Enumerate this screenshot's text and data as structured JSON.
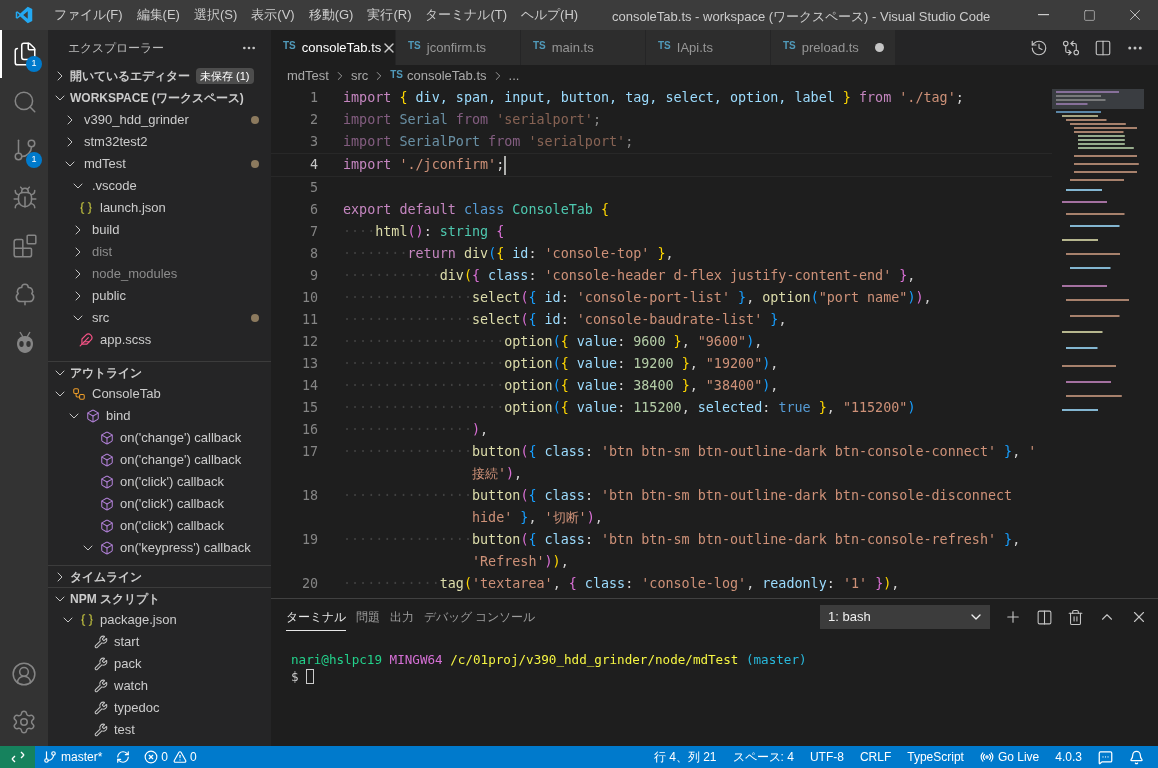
{
  "window": {
    "title": "consoleTab.ts - workspace (ワークスペース) - Visual Studio Code"
  },
  "menu": {
    "items": [
      "ファイル(F)",
      "編集(E)",
      "選択(S)",
      "表示(V)",
      "移動(G)",
      "実行(R)",
      "ターミナル(T)",
      "ヘルプ(H)"
    ]
  },
  "activity_bar": {
    "items": [
      {
        "kind": "files",
        "selected": true,
        "badge": "1"
      },
      {
        "kind": "search",
        "selected": false
      },
      {
        "kind": "source_control",
        "selected": false,
        "badge": "1"
      },
      {
        "kind": "run_debug",
        "selected": false
      },
      {
        "kind": "extensions",
        "selected": false
      },
      {
        "kind": "testing",
        "selected": false
      },
      {
        "kind": "alien",
        "selected": false
      }
    ],
    "bottom": [
      {
        "kind": "account"
      },
      {
        "kind": "settings"
      }
    ]
  },
  "sidebar": {
    "title": "エクスプローラー",
    "open_editors": {
      "label": "開いているエディター",
      "badge": "未保存 (1)",
      "expanded": false
    },
    "workspace": {
      "label": "WORKSPACE (ワークスペース)",
      "expanded": true,
      "items": [
        {
          "kind": "folder",
          "label": "v390_hdd_grinder",
          "expanded": false,
          "modified": true
        },
        {
          "kind": "folder",
          "label": "stm32test2",
          "expanded": false,
          "modified": false
        },
        {
          "kind": "folder",
          "label": "mdTest",
          "expanded": true,
          "modified": true,
          "children": [
            {
              "kind": "folder",
              "label": ".vscode",
              "expanded": true,
              "modified": false,
              "children": [
                {
                  "kind": "json",
                  "label": "launch.json"
                }
              ]
            },
            {
              "kind": "folder",
              "label": "build",
              "expanded": false,
              "modified": false
            },
            {
              "kind": "folder",
              "label": "dist",
              "expanded": false,
              "modified": false,
              "ignored": true
            },
            {
              "kind": "folder",
              "label": "node_modules",
              "expanded": false,
              "modified": false,
              "ignored": true
            },
            {
              "kind": "folder",
              "label": "public",
              "expanded": false,
              "modified": false
            },
            {
              "kind": "folder",
              "label": "src",
              "expanded": true,
              "modified": true,
              "children": [
                {
                  "kind": "scss",
                  "label": "app.scss"
                }
              ]
            }
          ]
        }
      ]
    },
    "outline": {
      "label": "アウトライン",
      "expanded": true,
      "items": [
        {
          "kind": "class",
          "label": "ConsoleTab",
          "expanded": true,
          "children": [
            {
              "kind": "member",
              "label": "bind",
              "expanded": true,
              "children": [
                {
                  "kind": "member",
                  "label": "on('change') callback"
                },
                {
                  "kind": "member",
                  "label": "on('change') callback"
                },
                {
                  "kind": "member",
                  "label": "on('click') callback"
                },
                {
                  "kind": "member",
                  "label": "on('click') callback"
                },
                {
                  "kind": "member",
                  "label": "on('click') callback"
                },
                {
                  "kind": "member",
                  "label": "on('keypress') callback",
                  "expanded": true
                }
              ]
            }
          ]
        }
      ]
    },
    "timeline": {
      "label": "タイムライン",
      "expanded": false
    },
    "npm_scripts": {
      "label": "NPM スクリプト",
      "expanded": true,
      "items": [
        {
          "kind": "package",
          "label": "package.json",
          "expanded": true,
          "children": [
            {
              "kind": "script",
              "label": "start"
            },
            {
              "kind": "script",
              "label": "pack"
            },
            {
              "kind": "script",
              "label": "watch"
            },
            {
              "kind": "script",
              "label": "typedoc"
            },
            {
              "kind": "script",
              "label": "test"
            }
          ]
        }
      ]
    }
  },
  "tabs": [
    {
      "label": "consoleTab.ts",
      "badge": "TS",
      "selected": true,
      "dirty": false
    },
    {
      "label": "jconfirm.ts",
      "badge": "TS",
      "selected": false,
      "dirty": false
    },
    {
      "label": "main.ts",
      "badge": "TS",
      "selected": false,
      "dirty": false
    },
    {
      "label": "IApi.ts",
      "badge": "TS",
      "selected": false,
      "dirty": false
    },
    {
      "label": "preload.ts",
      "badge": "TS",
      "selected": false,
      "dirty": true
    }
  ],
  "breadcrumb": [
    {
      "kind": "folder",
      "text": "mdTest"
    },
    {
      "kind": "folder",
      "text": "src"
    },
    {
      "kind": "file",
      "badge": "TS",
      "text": "consoleTab.ts"
    },
    {
      "kind": "more",
      "text": "..."
    }
  ],
  "editor": {
    "lines": [
      {
        "number": "1",
        "rows": [
          [
            {
              "kind": "keyword",
              "text": "import"
            },
            {
              "kind": "punct",
              "text": " "
            },
            {
              "kind": "bracket1",
              "text": "{"
            },
            {
              "kind": "property",
              "text": " div, span, input, button, tag, select, option, label "
            },
            {
              "kind": "bracket1",
              "text": "}"
            },
            {
              "kind": "keyword",
              "text": " from "
            },
            {
              "kind": "string",
              "text": "'./tag'"
            },
            {
              "kind": "punct",
              "text": ";"
            }
          ]
        ]
      },
      {
        "number": "2",
        "faded": true,
        "rows": [
          [
            {
              "kind": "keyword",
              "text": "import "
            },
            {
              "kind": "property",
              "text": "Serial"
            },
            {
              "kind": "keyword",
              "text": " from "
            },
            {
              "kind": "string",
              "text": "'serialport'"
            },
            {
              "kind": "punct",
              "text": ";"
            }
          ]
        ]
      },
      {
        "number": "3",
        "faded": true,
        "rows": [
          [
            {
              "kind": "keyword",
              "text": "import "
            },
            {
              "kind": "property",
              "text": "SerialPort"
            },
            {
              "kind": "keyword",
              "text": " from "
            },
            {
              "kind": "string",
              "text": "'serialport'"
            },
            {
              "kind": "punct",
              "text": ";"
            }
          ]
        ]
      },
      {
        "number": "4",
        "cursor": true,
        "rows": [
          [
            {
              "kind": "keyword",
              "text": "import "
            },
            {
              "kind": "string",
              "text": "'./jconfirm'"
            },
            {
              "kind": "punct",
              "text": ";"
            }
          ]
        ]
      },
      {
        "number": "5"
      },
      {
        "number": "6",
        "rows": [
          [
            {
              "kind": "keyword",
              "text": "export default "
            },
            {
              "kind": "storage",
              "text": "class "
            },
            {
              "kind": "type",
              "text": "ConsoleTab "
            },
            {
              "kind": "bracket1",
              "text": "{"
            }
          ]
        ]
      },
      {
        "number": "7",
        "rows": [
          [
            {
              "kind": "space",
              "text": "····"
            },
            {
              "kind": "function",
              "text": "html"
            },
            {
              "kind": "bracket2",
              "text": "()"
            },
            {
              "kind": "punct",
              "text": ": "
            },
            {
              "kind": "type",
              "text": "string"
            },
            {
              "kind": "punct",
              "text": " "
            },
            {
              "kind": "bracket2",
              "text": "{"
            }
          ]
        ]
      },
      {
        "number": "8",
        "rows": [
          [
            {
              "kind": "space",
              "text": "········"
            },
            {
              "kind": "keyword",
              "text": "return "
            },
            {
              "kind": "function",
              "text": "div"
            },
            {
              "kind": "bracket3",
              "text": "("
            },
            {
              "kind": "bracket1",
              "text": "{"
            },
            {
              "kind": "property",
              "text": " id"
            },
            {
              "kind": "punct",
              "text": ": "
            },
            {
              "kind": "string",
              "text": "'console-top'"
            },
            {
              "kind": "punct",
              "text": " "
            },
            {
              "kind": "bracket1",
              "text": "}"
            },
            {
              "kind": "punct",
              "text": ","
            }
          ]
        ]
      },
      {
        "number": "9",
        "rows": [
          [
            {
              "kind": "space",
              "text": "············"
            },
            {
              "kind": "function",
              "text": "div"
            },
            {
              "kind": "bracket1",
              "text": "("
            },
            {
              "kind": "bracket2",
              "text": "{"
            },
            {
              "kind": "property",
              "text": " class"
            },
            {
              "kind": "punct",
              "text": ": "
            },
            {
              "kind": "string",
              "text": "'console-header d-flex justify-content-end'"
            },
            {
              "kind": "punct",
              "text": " "
            },
            {
              "kind": "bracket2",
              "text": "}"
            },
            {
              "kind": "punct",
              "text": ","
            }
          ]
        ]
      },
      {
        "number": "10",
        "rows": [
          [
            {
              "kind": "space",
              "text": "················"
            },
            {
              "kind": "function",
              "text": "select"
            },
            {
              "kind": "bracket2",
              "text": "("
            },
            {
              "kind": "bracket3",
              "text": "{"
            },
            {
              "kind": "property",
              "text": " id"
            },
            {
              "kind": "punct",
              "text": ": "
            },
            {
              "kind": "string",
              "text": "'console-port-list'"
            },
            {
              "kind": "punct",
              "text": " "
            },
            {
              "kind": "bracket3",
              "text": "}"
            },
            {
              "kind": "punct",
              "text": ", "
            },
            {
              "kind": "function",
              "text": "option"
            },
            {
              "kind": "bracket3",
              "text": "("
            },
            {
              "kind": "string",
              "text": "\"port name\""
            },
            {
              "kind": "bracket3",
              "text": ")"
            },
            {
              "kind": "bracket2",
              "text": ")"
            },
            {
              "kind": "punct",
              "text": ","
            }
          ]
        ]
      },
      {
        "number": "11",
        "rows": [
          [
            {
              "kind": "space",
              "text": "················"
            },
            {
              "kind": "function",
              "text": "select"
            },
            {
              "kind": "bracket2",
              "text": "("
            },
            {
              "kind": "bracket3",
              "text": "{"
            },
            {
              "kind": "property",
              "text": " id"
            },
            {
              "kind": "punct",
              "text": ": "
            },
            {
              "kind": "string",
              "text": "'console-baudrate-list'"
            },
            {
              "kind": "punct",
              "text": " "
            },
            {
              "kind": "bracket3",
              "text": "}"
            },
            {
              "kind": "punct",
              "text": ","
            }
          ]
        ]
      },
      {
        "number": "12",
        "rows": [
          [
            {
              "kind": "space",
              "text": "····················"
            },
            {
              "kind": "function",
              "text": "option"
            },
            {
              "kind": "bracket3",
              "text": "("
            },
            {
              "kind": "bracket1",
              "text": "{"
            },
            {
              "kind": "property",
              "text": " value"
            },
            {
              "kind": "punct",
              "text": ": "
            },
            {
              "kind": "number",
              "text": "9600"
            },
            {
              "kind": "punct",
              "text": " "
            },
            {
              "kind": "bracket1",
              "text": "}"
            },
            {
              "kind": "punct",
              "text": ", "
            },
            {
              "kind": "string",
              "text": "\"9600\""
            },
            {
              "kind": "bracket3",
              "text": ")"
            },
            {
              "kind": "punct",
              "text": ","
            }
          ]
        ]
      },
      {
        "number": "13",
        "rows": [
          [
            {
              "kind": "space",
              "text": "····················"
            },
            {
              "kind": "function",
              "text": "option"
            },
            {
              "kind": "bracket3",
              "text": "("
            },
            {
              "kind": "bracket1",
              "text": "{"
            },
            {
              "kind": "property",
              "text": " value"
            },
            {
              "kind": "punct",
              "text": ": "
            },
            {
              "kind": "number",
              "text": "19200"
            },
            {
              "kind": "punct",
              "text": " "
            },
            {
              "kind": "bracket1",
              "text": "}"
            },
            {
              "kind": "punct",
              "text": ", "
            },
            {
              "kind": "string",
              "text": "\"19200\""
            },
            {
              "kind": "bracket3",
              "text": ")"
            },
            {
              "kind": "punct",
              "text": ","
            }
          ]
        ]
      },
      {
        "number": "14",
        "rows": [
          [
            {
              "kind": "space",
              "text": "····················"
            },
            {
              "kind": "function",
              "text": "option"
            },
            {
              "kind": "bracket3",
              "text": "("
            },
            {
              "kind": "bracket1",
              "text": "{"
            },
            {
              "kind": "property",
              "text": " value"
            },
            {
              "kind": "punct",
              "text": ": "
            },
            {
              "kind": "number",
              "text": "38400"
            },
            {
              "kind": "punct",
              "text": " "
            },
            {
              "kind": "bracket1",
              "text": "}"
            },
            {
              "kind": "punct",
              "text": ", "
            },
            {
              "kind": "string",
              "text": "\"38400\""
            },
            {
              "kind": "bracket3",
              "text": ")"
            },
            {
              "kind": "punct",
              "text": ","
            }
          ]
        ]
      },
      {
        "number": "15",
        "rows": [
          [
            {
              "kind": "space",
              "text": "····················"
            },
            {
              "kind": "function",
              "text": "option"
            },
            {
              "kind": "bracket3",
              "text": "("
            },
            {
              "kind": "bracket1",
              "text": "{"
            },
            {
              "kind": "property",
              "text": " value"
            },
            {
              "kind": "punct",
              "text": ": "
            },
            {
              "kind": "number",
              "text": "115200"
            },
            {
              "kind": "punct",
              "text": ", "
            },
            {
              "kind": "property",
              "text": "selected"
            },
            {
              "kind": "punct",
              "text": ": "
            },
            {
              "kind": "storage",
              "text": "true"
            },
            {
              "kind": "punct",
              "text": " "
            },
            {
              "kind": "bracket1",
              "text": "}"
            },
            {
              "kind": "punct",
              "text": ", "
            },
            {
              "kind": "string",
              "text": "\"115200\""
            },
            {
              "kind": "bracket3",
              "text": ")"
            }
          ]
        ]
      },
      {
        "number": "16",
        "rows": [
          [
            {
              "kind": "space",
              "text": "················"
            },
            {
              "kind": "bracket2",
              "text": ")"
            },
            {
              "kind": "punct",
              "text": ","
            }
          ]
        ]
      },
      {
        "number": "17",
        "rows": [
          [
            {
              "kind": "space",
              "text": "················"
            },
            {
              "kind": "function",
              "text": "button"
            },
            {
              "kind": "bracket2",
              "text": "("
            },
            {
              "kind": "bracket3",
              "text": "{"
            },
            {
              "kind": "property",
              "text": " class"
            },
            {
              "kind": "punct",
              "text": ": "
            },
            {
              "kind": "string",
              "text": "'btn btn-sm btn-outline-dark btn-console-connect'"
            },
            {
              "kind": "punct",
              "text": " "
            },
            {
              "kind": "bracket3",
              "text": "}"
            },
            {
              "kind": "punct",
              "text": ", "
            },
            {
              "kind": "string",
              "text": "'"
            },
            {
              "kind": "wrap"
            },
            {
              "kind": "string",
              "text": "接続'"
            },
            {
              "kind": "bracket2",
              "text": ")"
            },
            {
              "kind": "punct",
              "text": ","
            }
          ]
        ]
      },
      {
        "number": "18",
        "rows": [
          [
            {
              "kind": "space",
              "text": "················"
            },
            {
              "kind": "function",
              "text": "button"
            },
            {
              "kind": "bracket2",
              "text": "("
            },
            {
              "kind": "bracket3",
              "text": "{"
            },
            {
              "kind": "property",
              "text": " class"
            },
            {
              "kind": "punct",
              "text": ": "
            },
            {
              "kind": "string",
              "text": "'btn btn-sm btn-outline-dark btn-console-disconnect"
            },
            {
              "kind": "wrap"
            },
            {
              "kind": "string",
              "text": "hide'"
            },
            {
              "kind": "punct",
              "text": " "
            },
            {
              "kind": "bracket3",
              "text": "}"
            },
            {
              "kind": "punct",
              "text": ", "
            },
            {
              "kind": "string",
              "text": "'切断'"
            },
            {
              "kind": "bracket2",
              "text": ")"
            },
            {
              "kind": "punct",
              "text": ","
            }
          ]
        ]
      },
      {
        "number": "19",
        "rows": [
          [
            {
              "kind": "space",
              "text": "················"
            },
            {
              "kind": "function",
              "text": "button"
            },
            {
              "kind": "bracket2",
              "text": "("
            },
            {
              "kind": "bracket3",
              "text": "{"
            },
            {
              "kind": "property",
              "text": " class"
            },
            {
              "kind": "punct",
              "text": ": "
            },
            {
              "kind": "string",
              "text": "'btn btn-sm btn-outline-dark btn-console-refresh'"
            },
            {
              "kind": "punct",
              "text": " "
            },
            {
              "kind": "bracket3",
              "text": "}"
            },
            {
              "kind": "punct",
              "text": ","
            },
            {
              "kind": "wrap"
            },
            {
              "kind": "string",
              "text": "'Refresh'"
            },
            {
              "kind": "bracket2",
              "text": ")"
            },
            {
              "kind": "bracket1",
              "text": ")"
            },
            {
              "kind": "punct",
              "text": ","
            }
          ]
        ]
      },
      {
        "number": "20",
        "rows": [
          [
            {
              "kind": "space",
              "text": "············"
            },
            {
              "kind": "function",
              "text": "tag"
            },
            {
              "kind": "bracket1",
              "text": "("
            },
            {
              "kind": "string",
              "text": "'textarea'"
            },
            {
              "kind": "punct",
              "text": ", "
            },
            {
              "kind": "bracket2",
              "text": "{"
            },
            {
              "kind": "property",
              "text": " class"
            },
            {
              "kind": "punct",
              "text": ": "
            },
            {
              "kind": "string",
              "text": "'console-log'"
            },
            {
              "kind": "punct",
              "text": ", "
            },
            {
              "kind": "property",
              "text": "readonly"
            },
            {
              "kind": "punct",
              "text": ": "
            },
            {
              "kind": "string",
              "text": "'1'"
            },
            {
              "kind": "punct",
              "text": " "
            },
            {
              "kind": "bracket2",
              "text": "}"
            },
            {
              "kind": "bracket1",
              "text": ")"
            },
            {
              "kind": "punct",
              "text": ","
            }
          ]
        ]
      }
    ]
  },
  "panel": {
    "tabs": [
      {
        "label": "ターミナル",
        "selected": true
      },
      {
        "label": "問題",
        "selected": false
      },
      {
        "label": "出力",
        "selected": false
      },
      {
        "label": "デバッグ コンソール",
        "selected": false
      }
    ],
    "terminal_select": "1: bash",
    "terminal": {
      "cursor": true,
      "lines": [
        [
          {
            "kind": "user",
            "text": "nari@hslpc19 "
          },
          {
            "kind": "system",
            "text": "MINGW64 "
          },
          {
            "kind": "path",
            "text": "/c/01proj/v390_hdd_grinder/node/mdTest "
          },
          {
            "kind": "branch",
            "text": "(master)"
          }
        ],
        [
          {
            "kind": "plain",
            "text": "$ "
          }
        ]
      ]
    }
  },
  "status_bar": {
    "branch": "master*",
    "errors": "0",
    "warnings": "0",
    "right": [
      {
        "kind": "text",
        "text": "行 4、列 21"
      },
      {
        "kind": "text",
        "text": "スペース: 4"
      },
      {
        "kind": "text",
        "text": "UTF-8"
      },
      {
        "kind": "text",
        "text": "CRLF"
      },
      {
        "kind": "text",
        "text": "TypeScript"
      },
      {
        "kind": "live",
        "text": "Go Live"
      },
      {
        "kind": "text",
        "text": "4.0.3"
      },
      {
        "kind": "feedback"
      },
      {
        "kind": "bell"
      }
    ]
  }
}
